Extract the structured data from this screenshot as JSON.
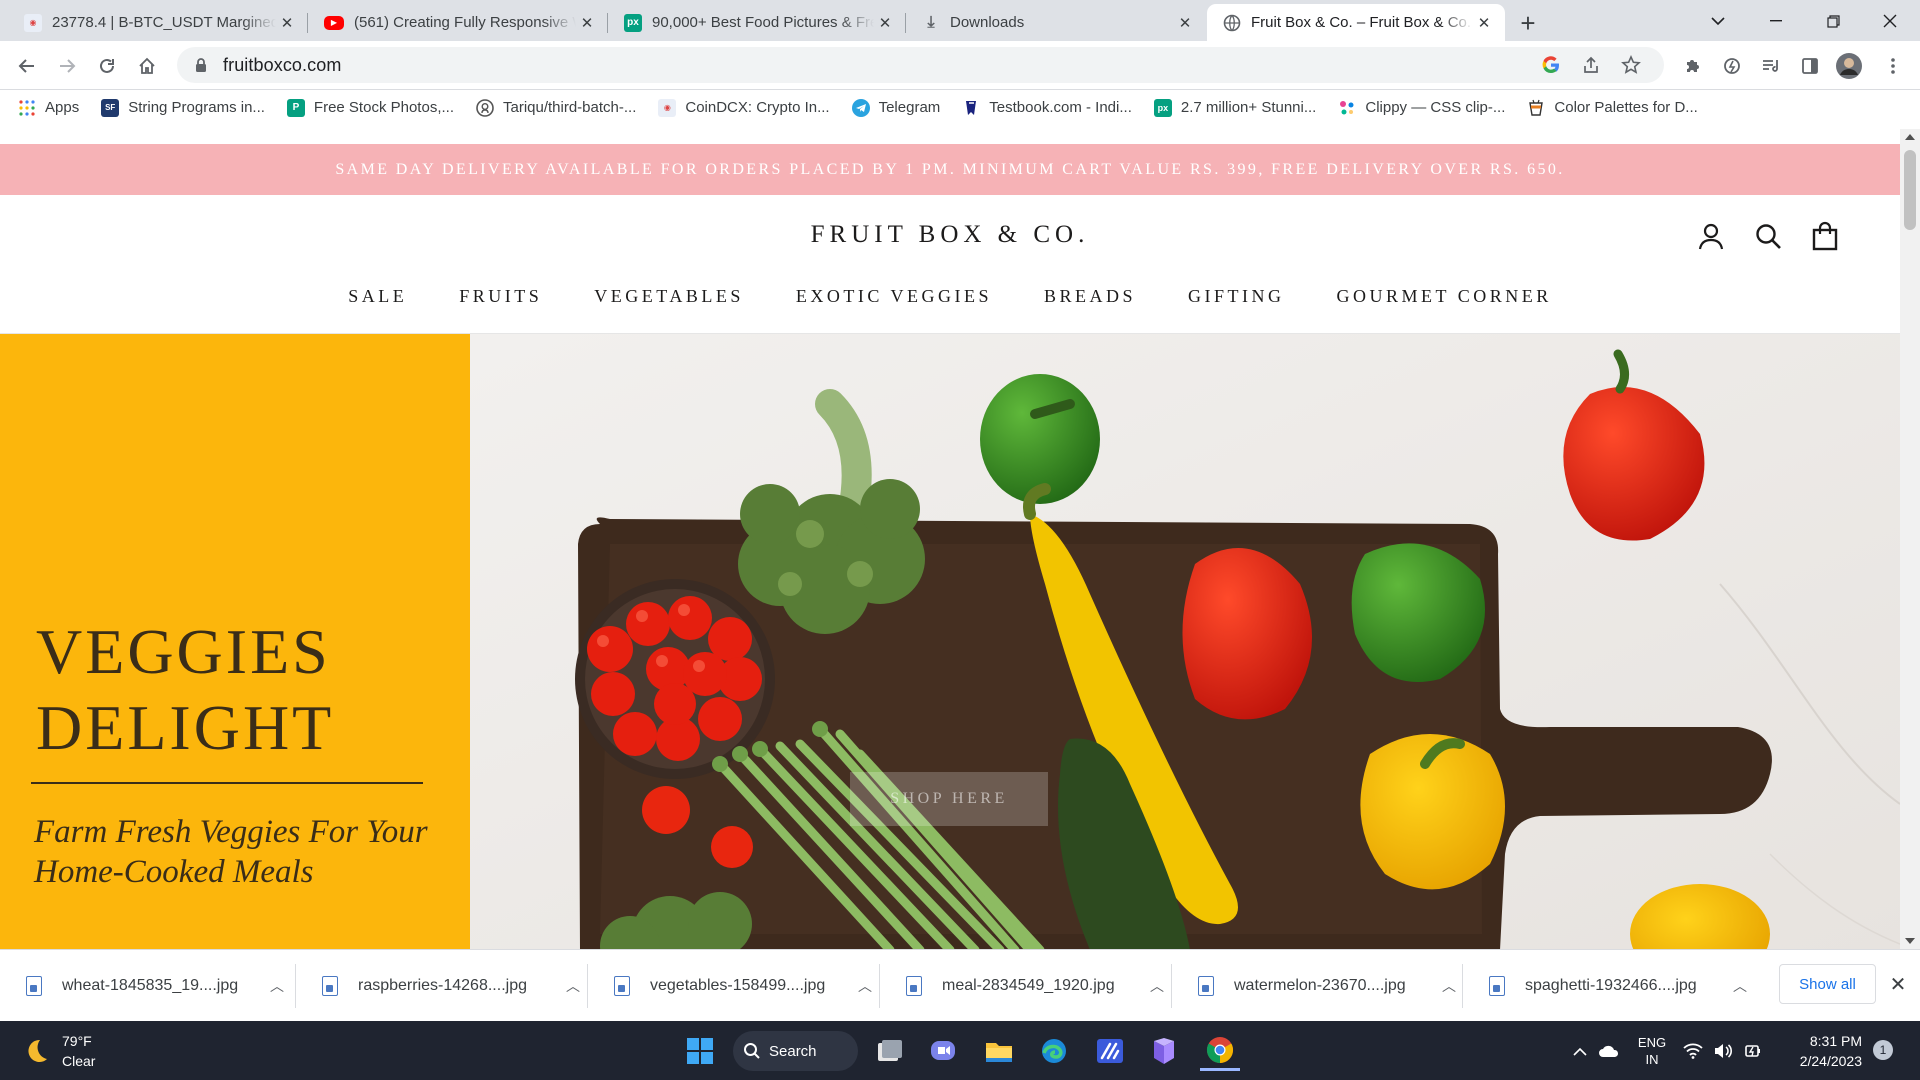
{
  "browser": {
    "tabs": [
      {
        "title": "23778.4 | B-BTC_USDT Margined",
        "favicon": "coindcx-icon",
        "color": "#e9eef7"
      },
      {
        "title": "(561) Creating Fully Responsive W",
        "favicon": "youtube-icon",
        "color": "#ff0000"
      },
      {
        "title": "90,000+ Best Food Pictures & Fre",
        "favicon": "pexels-icon",
        "color": "#05a081"
      },
      {
        "title": "Downloads",
        "favicon": "download-icon",
        "color": "#5f6368"
      },
      {
        "title": "Fruit Box & Co. – Fruit Box & Co.",
        "favicon": "globe-icon",
        "color": "#5f6368",
        "active": true
      }
    ],
    "new_tab_label": "+",
    "url": "fruitboxco.com",
    "bookmarks": [
      {
        "label": "Apps",
        "icon": "apps-grid-icon",
        "color": "#4285f4"
      },
      {
        "label": "String Programs in...",
        "icon": "sf-icon",
        "color": "#203a6d"
      },
      {
        "label": "Free Stock Photos,...",
        "icon": "pexels-icon",
        "color": "#05a081"
      },
      {
        "label": "Tariqu/third-batch-...",
        "icon": "github-icon",
        "color": "#24292e"
      },
      {
        "label": "CoinDCX: Crypto In...",
        "icon": "coindcx-icon",
        "color": "#e9eef7"
      },
      {
        "label": "Telegram",
        "icon": "telegram-icon",
        "color": "#2aa3df"
      },
      {
        "label": "Testbook.com - Indi...",
        "icon": "testbook-icon",
        "color": "#1a237e"
      },
      {
        "label": "2.7 million+ Stunni...",
        "icon": "pexels-icon",
        "color": "#05a081"
      },
      {
        "label": "Clippy — CSS clip-...",
        "icon": "clippy-icon",
        "color": "#8e44ad"
      },
      {
        "label": "Color Palettes for D...",
        "icon": "cup-icon",
        "color": "#333333"
      }
    ]
  },
  "site": {
    "announcement": "SAME DAY DELIVERY AVAILABLE FOR ORDERS PLACED BY 1 PM. MINIMUM CART VALUE RS. 399, FREE DELIVERY OVER RS. 650.",
    "brand": "FRUIT BOX & CO.",
    "nav": [
      "SALE",
      "FRUITS",
      "VEGETABLES",
      "EXOTIC VEGGIES",
      "BREADS",
      "GIFTING",
      "GOURMET CORNER"
    ],
    "hero": {
      "title_line1": "VEGGIES",
      "title_line2": "DELIGHT",
      "subtitle_line1": "Farm Fresh Veggies For Your",
      "subtitle_line2": "Home-Cooked Meals",
      "cta": "SHOP HERE",
      "accent_color": "#fcb60c"
    },
    "announcement_color": "#f6b2b6"
  },
  "downloads": {
    "items": [
      "wheat-1845835_19....jpg",
      "raspberries-14268....jpg",
      "vegetables-158499....jpg",
      "meal-2834549_1920.jpg",
      "watermelon-23670....jpg",
      "spaghetti-1932466....jpg"
    ],
    "show_all": "Show all"
  },
  "taskbar": {
    "weather_temp": "79°F",
    "weather_desc": "Clear",
    "search_label": "Search",
    "lang_line1": "ENG",
    "lang_line2": "IN",
    "time": "8:31 PM",
    "date": "2/24/2023",
    "notification_count": "1"
  }
}
